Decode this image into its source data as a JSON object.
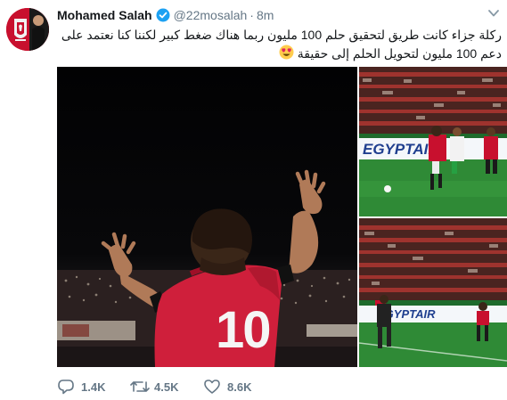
{
  "author": {
    "name": "Mohamed Salah",
    "handle": "@22mosalah",
    "separator": "·",
    "time": "8m",
    "verified": true
  },
  "tweet": {
    "text": "ركلة جزاء كانت طريق لتحقيق حلم 100 مليون ربما هناك ضغط كبير لكننا كنا نعتمد على دعم 100 مليون لتحويل الحلم إلى حقيقة"
  },
  "media": {
    "jersey_number": "10",
    "banner_text_top": "EGYPTAIR",
    "banner_text_bottom": "EGYPTAIR"
  },
  "actions": {
    "reply": {
      "icon": "reply-icon",
      "count": "1.4K"
    },
    "retweet": {
      "icon": "retweet-icon",
      "count": "4.5K"
    },
    "like": {
      "icon": "heart-icon",
      "count": "8.6K"
    }
  },
  "colors": {
    "verified": "#1da1f2",
    "muted": "#657786",
    "egypt_red": "#c8102e"
  }
}
